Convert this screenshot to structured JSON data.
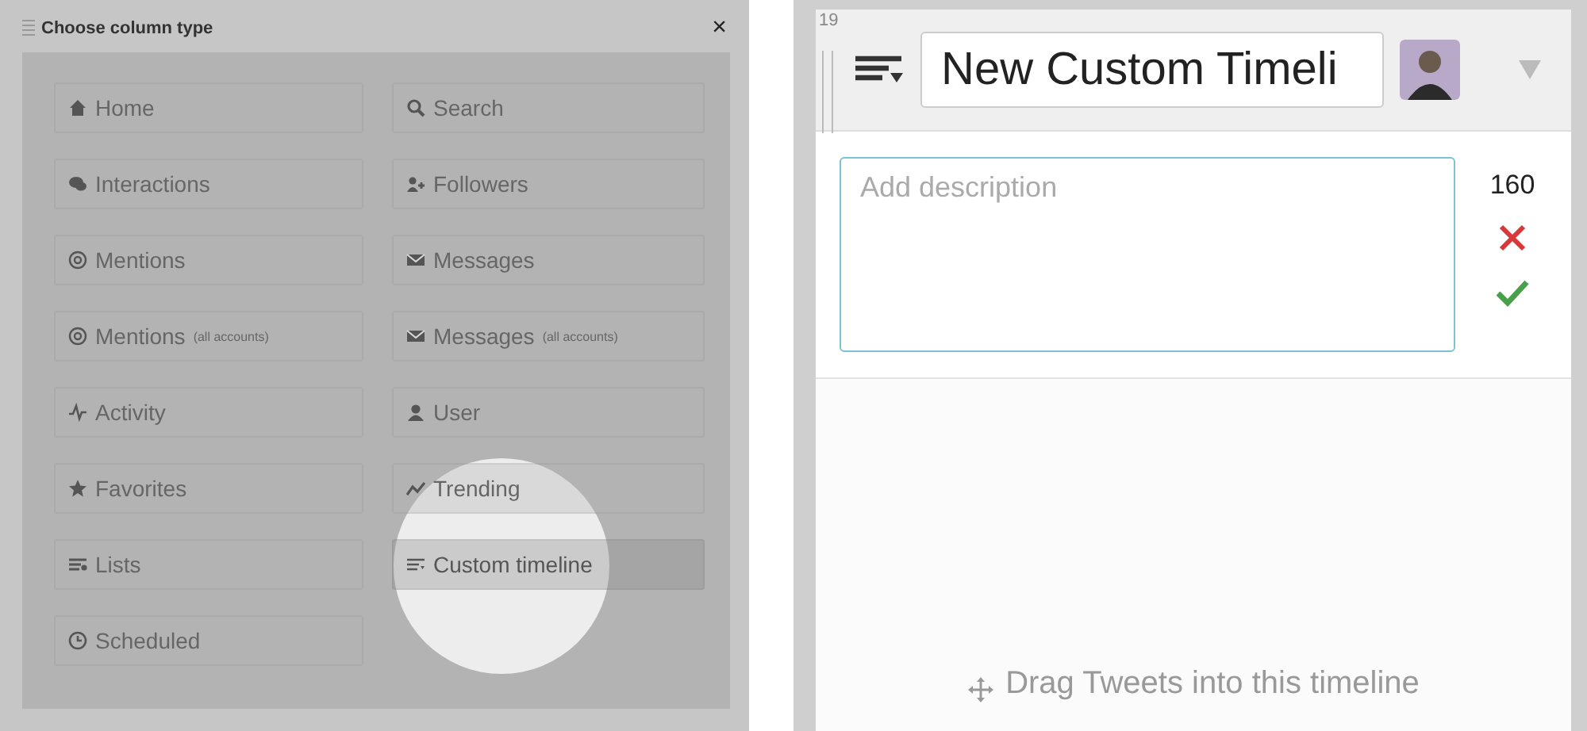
{
  "dialog": {
    "title": "Choose column type",
    "close": "×",
    "column_types": [
      {
        "label": "Home",
        "kind": "home",
        "selected": false
      },
      {
        "label": "Search",
        "kind": "search",
        "selected": false
      },
      {
        "label": "Interactions",
        "kind": "chat",
        "selected": false
      },
      {
        "label": "Followers",
        "kind": "follow",
        "selected": false
      },
      {
        "label": "Mentions",
        "kind": "at",
        "selected": false
      },
      {
        "label": "Messages",
        "kind": "mail",
        "selected": false
      },
      {
        "label": "Mentions",
        "note": "(all accounts)",
        "kind": "at",
        "selected": false
      },
      {
        "label": "Messages",
        "note": "(all accounts)",
        "kind": "mail",
        "selected": false
      },
      {
        "label": "Activity",
        "kind": "pulse",
        "selected": false
      },
      {
        "label": "User",
        "kind": "user",
        "selected": false
      },
      {
        "label": "Favorites",
        "kind": "star",
        "selected": false
      },
      {
        "label": "Trending",
        "kind": "trend",
        "selected": false
      },
      {
        "label": "Lists",
        "kind": "list",
        "selected": false
      },
      {
        "label": "Custom timeline",
        "kind": "custom",
        "selected": true
      },
      {
        "label": "Scheduled",
        "kind": "clock",
        "selected": false
      }
    ]
  },
  "column": {
    "index": "19",
    "title": "New Custom Timeli",
    "description": {
      "placeholder": "Add description"
    },
    "char_count": "160",
    "hint": "Drag Tweets into this timeline"
  }
}
